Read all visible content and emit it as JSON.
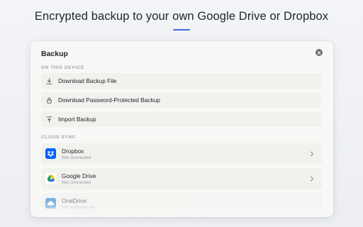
{
  "headline": "Encrypted backup to your own Google Drive or Dropbox",
  "dialog": {
    "title": "Backup",
    "local_section_label": "ON THIS DEVICE",
    "local_items": [
      {
        "label": "Download Backup File",
        "icon": "download-icon"
      },
      {
        "label": "Download Password-Protected Backup",
        "icon": "lock-icon"
      },
      {
        "label": "Import Backup",
        "icon": "upload-icon"
      }
    ],
    "cloud_section_label": "CLOUD SYNC",
    "cloud_items": [
      {
        "name": "Dropbox",
        "status": "Not connected",
        "icon": "dropbox-icon"
      },
      {
        "name": "Google Drive",
        "status": "Not connected",
        "icon": "google-drive-icon"
      },
      {
        "name": "OneDrive",
        "status": "Not available yet",
        "icon": "onedrive-icon"
      }
    ]
  },
  "colors": {
    "accent": "#3b6fd6",
    "dropbox": "#0061fe",
    "onedrive": "#0f78d4"
  }
}
